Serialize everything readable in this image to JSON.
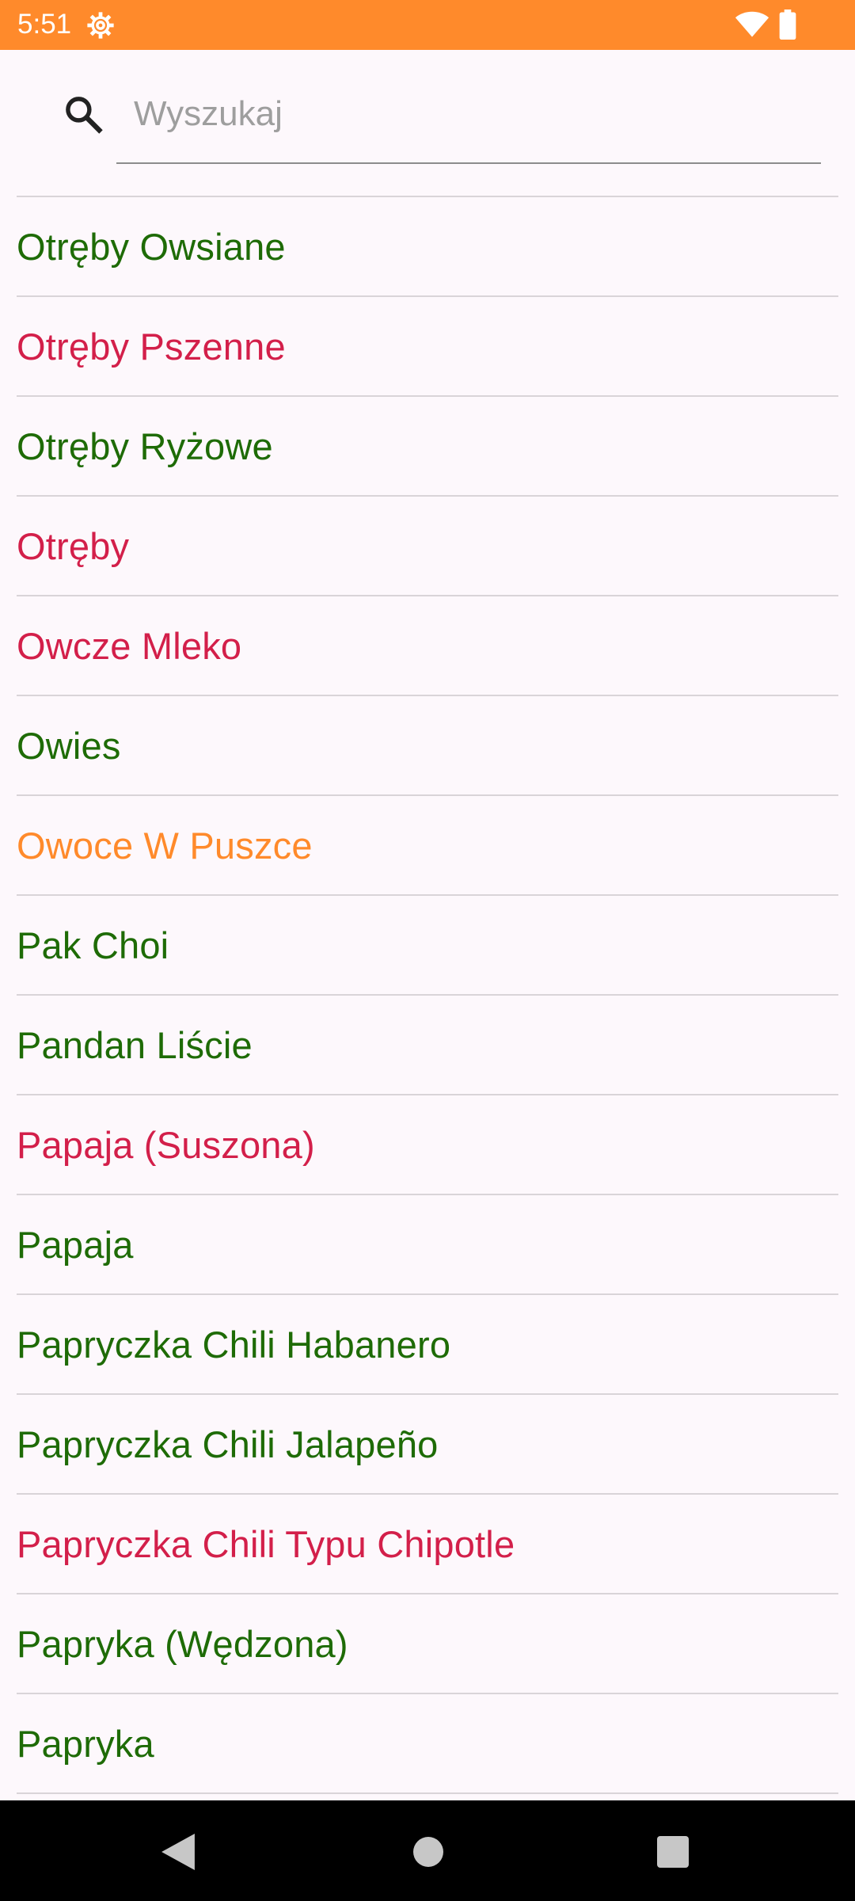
{
  "status_bar": {
    "time": "5:51",
    "background": "#ff8a2b",
    "icons": [
      "gear-icon",
      "wifi-icon",
      "battery-icon"
    ]
  },
  "search": {
    "placeholder": "Wyszukaj",
    "value": "",
    "icon": "search-icon"
  },
  "colors": {
    "green": "#1e6b06",
    "red": "#d31f4a",
    "orange": "#ff8a2b"
  },
  "items": [
    {
      "label": "Otręby Owsiane",
      "color": "green"
    },
    {
      "label": "Otręby Pszenne",
      "color": "red"
    },
    {
      "label": "Otręby Ryżowe",
      "color": "green"
    },
    {
      "label": "Otręby",
      "color": "red"
    },
    {
      "label": "Owcze Mleko",
      "color": "red"
    },
    {
      "label": "Owies",
      "color": "green"
    },
    {
      "label": "Owoce W Puszce",
      "color": "orange"
    },
    {
      "label": "Pak Choi",
      "color": "green"
    },
    {
      "label": "Pandan Liście",
      "color": "green"
    },
    {
      "label": "Papaja (Suszona)",
      "color": "red"
    },
    {
      "label": "Papaja",
      "color": "green"
    },
    {
      "label": "Papryczka Chili Habanero",
      "color": "green"
    },
    {
      "label": "Papryczka Chili Jalapeño",
      "color": "green"
    },
    {
      "label": "Papryczka Chili Typu Chipotle",
      "color": "red"
    },
    {
      "label": "Papryka (Wędzona)",
      "color": "green"
    },
    {
      "label": "Papryka",
      "color": "green"
    }
  ],
  "nav_bar": {
    "buttons": [
      "back-icon",
      "home-icon",
      "recents-icon"
    ]
  }
}
